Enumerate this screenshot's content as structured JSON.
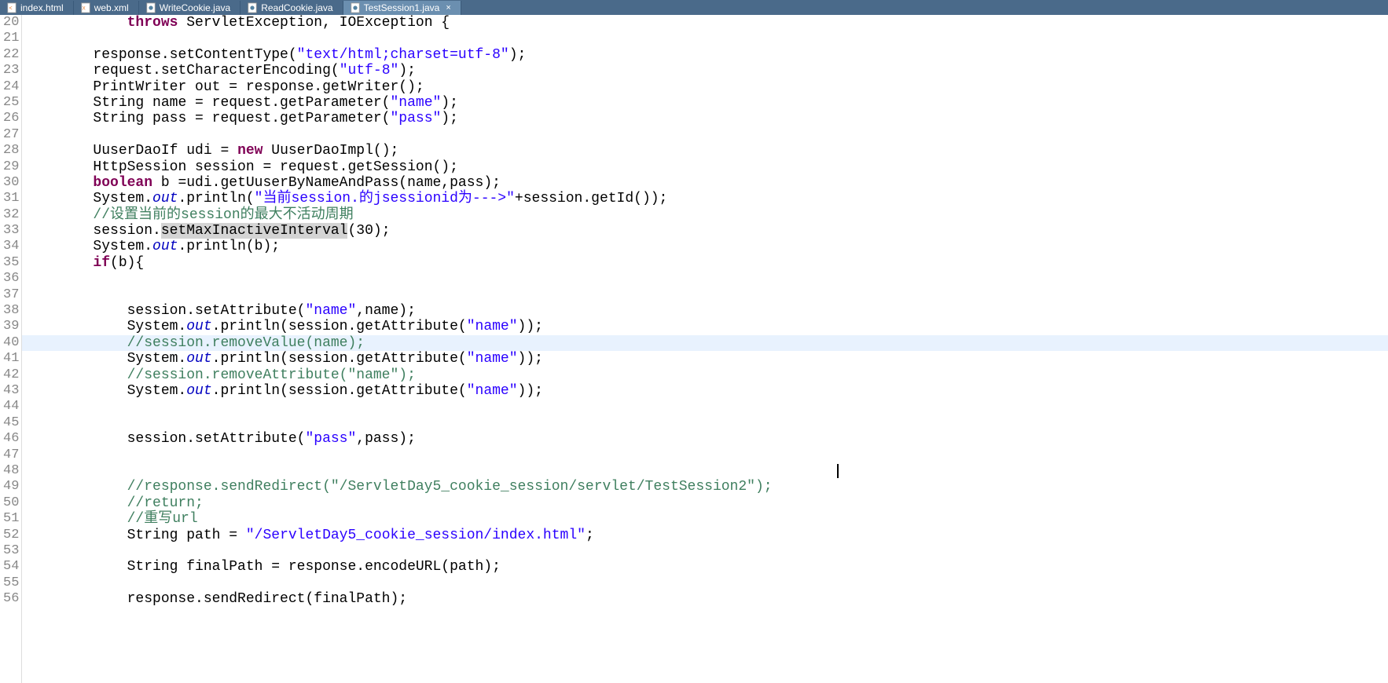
{
  "tabs": [
    {
      "label": "index.html",
      "icon": "html",
      "active": false
    },
    {
      "label": "web.xml",
      "icon": "xml",
      "active": false
    },
    {
      "label": "WriteCookie.java",
      "icon": "java",
      "active": false
    },
    {
      "label": "ReadCookie.java",
      "icon": "java",
      "active": false
    },
    {
      "label": "TestSession1.java",
      "icon": "java",
      "active": true
    }
  ],
  "lines": {
    "start": 20,
    "end": 56,
    "highlighted": 40
  },
  "code": {
    "l20": {
      "indent": "            ",
      "throws": "throws",
      "rest": " ServletException, IOException {"
    },
    "l21": "",
    "l22": {
      "indent": "        ",
      "pre": "response.setContentType(",
      "str": "\"text/html;charset=utf-8\"",
      "post": ");"
    },
    "l23": {
      "indent": "        ",
      "pre": "request.setCharacterEncoding(",
      "str": "\"utf-8\"",
      "post": ");"
    },
    "l24": {
      "indent": "        ",
      "text": "PrintWriter out = response.getWriter();"
    },
    "l25": {
      "indent": "        ",
      "pre": "String name = request.getParameter(",
      "str": "\"name\"",
      "post": ");"
    },
    "l26": {
      "indent": "        ",
      "pre": "String pass = request.getParameter(",
      "str": "\"pass\"",
      "post": ");"
    },
    "l27": "",
    "l28": {
      "indent": "        ",
      "pre": "UuserDaoIf udi = ",
      "kw": "new",
      "post": " UuserDaoImpl();"
    },
    "l29": {
      "indent": "        ",
      "text": "HttpSession session = request.getSession();"
    },
    "l30": {
      "indent": "        ",
      "kw": "boolean",
      "post": " b =udi.getUuserByNameAndPass(name,pass);"
    },
    "l31": {
      "indent": "        ",
      "pre": "System.",
      "field": "out",
      "pre2": ".println(",
      "str": "\"当前session.的jsessionid为--->\"",
      "post": "+session.getId());"
    },
    "l32": {
      "indent": "        ",
      "comment": "//设置当前的session的最大不活动周期"
    },
    "l33": {
      "indent": "        ",
      "pre": "session.",
      "hl": "setMaxInactiveInterval",
      "post": "(30);"
    },
    "l34": {
      "indent": "        ",
      "pre": "System.",
      "field": "out",
      "post": ".println(b);"
    },
    "l35": {
      "indent": "        ",
      "kw": "if",
      "post": "(b){"
    },
    "l36": "",
    "l37": "",
    "l38": {
      "indent": "            ",
      "pre": "session.setAttribute(",
      "str": "\"name\"",
      "post": ",name);"
    },
    "l39": {
      "indent": "            ",
      "pre": "System.",
      "field": "out",
      "pre2": ".println(session.getAttribute(",
      "str": "\"name\"",
      "post": "));"
    },
    "l40": {
      "indent": "            ",
      "comment": "//session.removeValue(name);"
    },
    "l41": {
      "indent": "            ",
      "pre": "System.",
      "field": "out",
      "pre2": ".println(session.getAttribute(",
      "str": "\"name\"",
      "post": "));"
    },
    "l42": {
      "indent": "            ",
      "comment": "//session.removeAttribute(\"name\");"
    },
    "l43": {
      "indent": "            ",
      "pre": "System.",
      "field": "out",
      "pre2": ".println(session.getAttribute(",
      "str": "\"name\"",
      "post": "));"
    },
    "l44": "",
    "l45": "",
    "l46": {
      "indent": "            ",
      "pre": "session.setAttribute(",
      "str": "\"pass\"",
      "post": ",pass);"
    },
    "l47": "",
    "l48": "",
    "l49": {
      "indent": "            ",
      "comment": "//response.sendRedirect(\"/ServletDay5_cookie_session/servlet/TestSession2\");"
    },
    "l50": {
      "indent": "            ",
      "comment": "//return;"
    },
    "l51": {
      "indent": "            ",
      "comment": "//重写url"
    },
    "l52": {
      "indent": "            ",
      "pre": "String path = ",
      "str": "\"/ServletDay5_cookie_session/index.html\"",
      "post": ";"
    },
    "l53": "",
    "l54": {
      "indent": "            ",
      "text": "String finalPath = response.encodeURL(path);"
    },
    "l55": "",
    "l56": {
      "indent": "            ",
      "text": "response.sendRedirect(finalPath);"
    }
  },
  "cursor": {
    "line": 48,
    "col": 96
  }
}
